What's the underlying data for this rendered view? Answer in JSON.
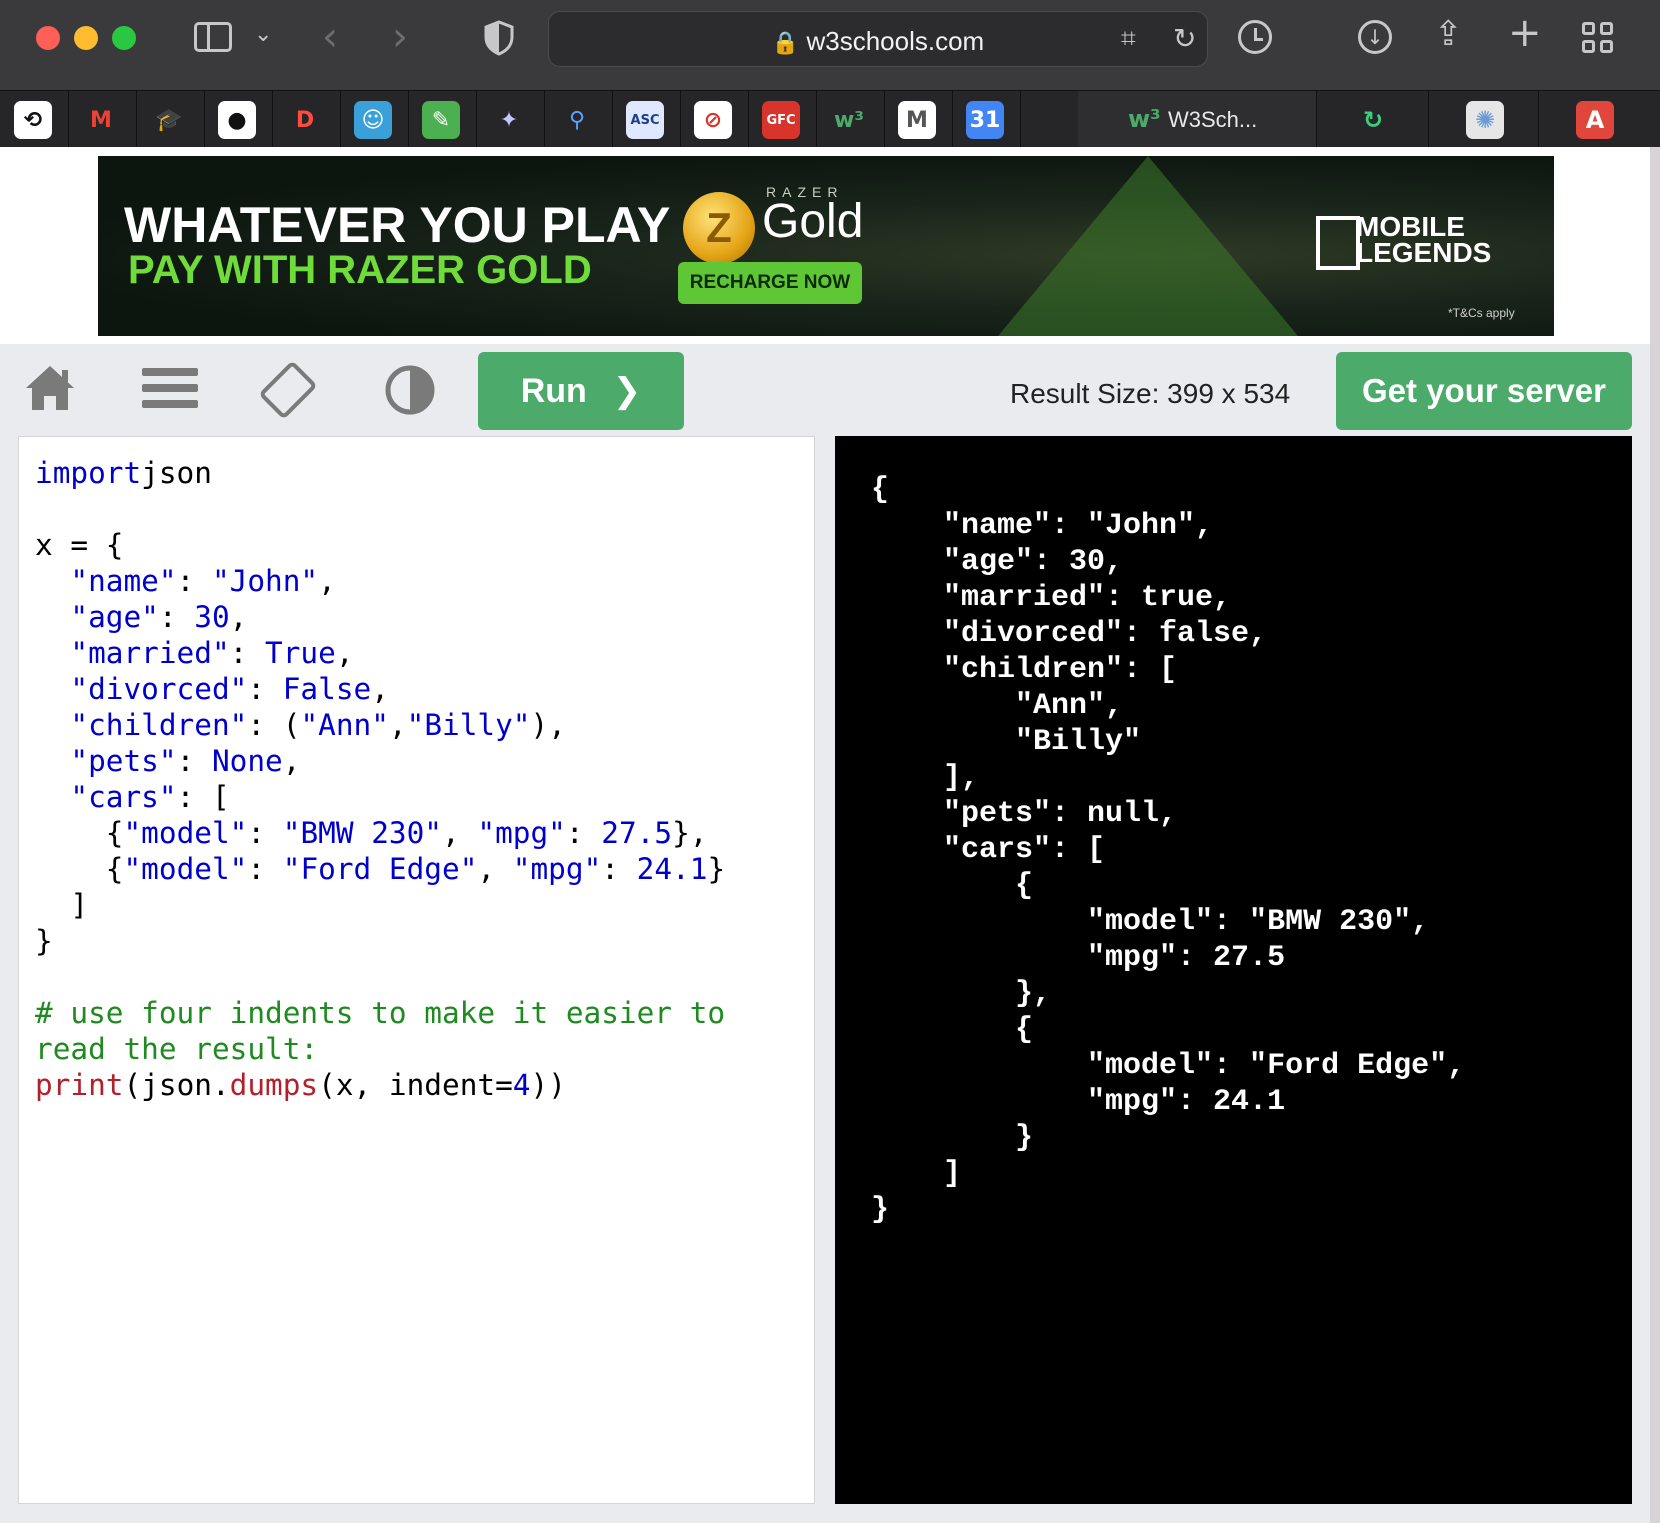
{
  "browser": {
    "url": "w3schools.com",
    "active_tab_label": "W3Sch...",
    "bookmarks": [
      {
        "icon": "speedify-icon",
        "glyph": "⟲",
        "bg": "#ffffff",
        "fg": "#111111"
      },
      {
        "icon": "gmail-icon",
        "glyph": "M",
        "bg": "#262628",
        "fg": "#ea4335"
      },
      {
        "icon": "graduation-cap-icon",
        "glyph": "🎓",
        "bg": "#262628",
        "fg": "#888888"
      },
      {
        "icon": "github-icon",
        "glyph": "●",
        "bg": "#ffffff",
        "fg": "#111111"
      },
      {
        "icon": "d-logo-icon",
        "glyph": "D",
        "bg": "#262628",
        "fg": "#ff4b3e"
      },
      {
        "icon": "bot-icon",
        "glyph": "☺",
        "bg": "#3aa0d8",
        "fg": "#ffffff"
      },
      {
        "icon": "leaf-icon",
        "glyph": "✎",
        "bg": "#4caf50",
        "fg": "#ffffff"
      },
      {
        "icon": "puzzle-icon",
        "glyph": "✦",
        "bg": "#262628",
        "fg": "#c7c7ff"
      },
      {
        "icon": "search-magnifier-icon",
        "glyph": "⚲",
        "bg": "#262628",
        "fg": "#5aa0ff"
      },
      {
        "icon": "asc-icon",
        "glyph": "ASC",
        "bg": "#dfe8ff",
        "fg": "#1f3d8a"
      },
      {
        "icon": "circle-slash-icon",
        "glyph": "⊘",
        "bg": "#ffffff",
        "fg": "#d9342b"
      },
      {
        "icon": "gfc-icon",
        "glyph": "GFC",
        "bg": "#d9342b",
        "fg": "#ffffff"
      },
      {
        "icon": "w3schools-icon",
        "glyph": "w³",
        "bg": "#262628",
        "fg": "#4caa6a"
      },
      {
        "icon": "m-frame-icon",
        "glyph": "M",
        "bg": "#ffffff",
        "fg": "#555555"
      },
      {
        "icon": "calendar-icon",
        "glyph": "31",
        "bg": "#4285f4",
        "fg": "#ffffff"
      }
    ],
    "tail_tabs": [
      {
        "icon": "refresh-green-icon",
        "glyph": "↻",
        "bg": "#262628",
        "fg": "#3ccf7a"
      },
      {
        "icon": "blur-icon",
        "glyph": "✺",
        "bg": "#e6e6e6",
        "fg": "#6a9bd8"
      },
      {
        "icon": "translate-icon",
        "glyph": "A",
        "bg": "#e0463b",
        "fg": "#ffffff"
      }
    ]
  },
  "ad": {
    "line1": "WHATEVER YOU PLAY",
    "line2": "PAY WITH RAZER GOLD",
    "brand_small": "RAZER",
    "brand_big": "Gold",
    "cta": "RECHARGE NOW",
    "game_line1": "MOBILE",
    "game_line2": "LEGENDS",
    "terms": "*T&Cs apply"
  },
  "toolbar": {
    "run_label": "Run",
    "result_size": "Result Size: 399 x 534",
    "server_label": "Get your server"
  },
  "code_lines": [
    [
      [
        "kw",
        "import"
      ],
      [
        "",
        "json"
      ]
    ],
    [],
    [
      [
        "",
        "x = {"
      ]
    ],
    [
      [
        "",
        "  "
      ],
      [
        "str",
        "\"name\""
      ],
      [
        "",
        ": "
      ],
      [
        "str",
        "\"John\""
      ],
      [
        "",
        ","
      ]
    ],
    [
      [
        "",
        "  "
      ],
      [
        "str",
        "\"age\""
      ],
      [
        "",
        ": "
      ],
      [
        "num",
        "30"
      ],
      [
        "",
        ","
      ]
    ],
    [
      [
        "",
        "  "
      ],
      [
        "str",
        "\"married\""
      ],
      [
        "",
        ": "
      ],
      [
        "kw",
        "True"
      ],
      [
        "",
        ","
      ]
    ],
    [
      [
        "",
        "  "
      ],
      [
        "str",
        "\"divorced\""
      ],
      [
        "",
        ": "
      ],
      [
        "kw",
        "False"
      ],
      [
        "",
        ","
      ]
    ],
    [
      [
        "",
        "  "
      ],
      [
        "str",
        "\"children\""
      ],
      [
        "",
        ": ("
      ],
      [
        "str",
        "\"Ann\""
      ],
      [
        "",
        ","
      ],
      [
        "str",
        "\"Billy\""
      ],
      [
        "",
        "),"
      ]
    ],
    [
      [
        "",
        "  "
      ],
      [
        "str",
        "\"pets\""
      ],
      [
        "",
        ": "
      ],
      [
        "kw",
        "None"
      ],
      [
        "",
        ","
      ]
    ],
    [
      [
        "",
        "  "
      ],
      [
        "str",
        "\"cars\""
      ],
      [
        "",
        ": ["
      ]
    ],
    [
      [
        "",
        "    {"
      ],
      [
        "str",
        "\"model\""
      ],
      [
        "",
        ": "
      ],
      [
        "str",
        "\"BMW 230\""
      ],
      [
        "",
        ", "
      ],
      [
        "str",
        "\"mpg\""
      ],
      [
        "",
        ": "
      ],
      [
        "num",
        "27.5"
      ],
      [
        "",
        "},"
      ]
    ],
    [
      [
        "",
        "    {"
      ],
      [
        "str",
        "\"model\""
      ],
      [
        "",
        ": "
      ],
      [
        "str",
        "\"Ford Edge\""
      ],
      [
        "",
        ", "
      ],
      [
        "str",
        "\"mpg\""
      ],
      [
        "",
        ": "
      ],
      [
        "num",
        "24.1"
      ],
      [
        "",
        "}"
      ]
    ],
    [
      [
        "",
        "  ]"
      ]
    ],
    [
      [
        "",
        "}"
      ]
    ],
    [],
    [
      [
        "com",
        "# use four indents to make it easier to"
      ]
    ],
    [
      [
        "com",
        "read the result:"
      ]
    ],
    [
      [
        "fn",
        "print"
      ],
      [
        "",
        "(json."
      ],
      [
        "fn",
        "dumps"
      ],
      [
        "",
        "(x, indent="
      ],
      [
        "num",
        "4"
      ],
      [
        "",
        "))"
      ]
    ]
  ],
  "output_lines": [
    "{",
    "    \"name\": \"John\",",
    "    \"age\": 30,",
    "    \"married\": true,",
    "    \"divorced\": false,",
    "    \"children\": [",
    "        \"Ann\",",
    "        \"Billy\"",
    "    ],",
    "    \"pets\": null,",
    "    \"cars\": [",
    "        {",
    "            \"model\": \"BMW 230\",",
    "            \"mpg\": 27.5",
    "        },",
    "        {",
    "            \"model\": \"Ford Edge\",",
    "            \"mpg\": 24.1",
    "        }",
    "    ]",
    "}"
  ]
}
